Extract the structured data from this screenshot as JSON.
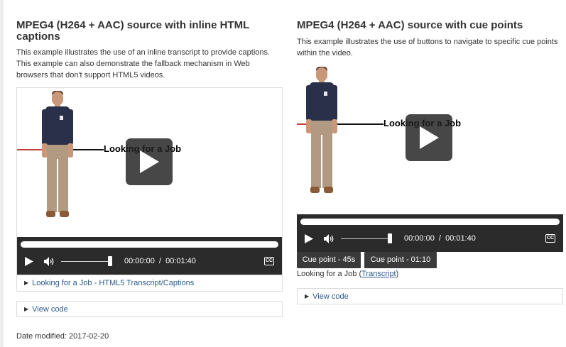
{
  "left": {
    "title": "MPEG4 (H264 + AAC) source with inline HTML captions",
    "description": "This example illustrates the use of an inline transcript to provide captions. This example can also demonstrate the fallback mechanism in Web browsers that don't support HTML5 videos.",
    "video_text": "Looking for a Job",
    "time": "00:00:00  /  00:01:40",
    "cc": "CC",
    "transcript_details": "Looking for a Job - HTML5 Transcript/Captions",
    "view_code": "View code"
  },
  "right": {
    "title": "MPEG4 (H264 + AAC) source with cue points",
    "description": "This example illustrates the use of buttons to navigate to specific cue points within the video.",
    "video_text": "Looking for a Job",
    "time": "00:00:00  /  00:01:40",
    "cc": "CC",
    "cue_buttons": [
      "Cue point - 45s",
      "Cue point - 01:10"
    ],
    "caption_prefix": "Looking for a Job (",
    "caption_link": "Transcript",
    "caption_suffix": ")",
    "view_code": "View code"
  },
  "footer": {
    "date_modified": "Date modified: 2017-02-20"
  },
  "icons": {
    "play": "play-icon",
    "volume": "volume-icon",
    "cc": "closed-captions-icon",
    "expand": "disclosure-triangle-icon"
  },
  "colors": {
    "control_bar": "#2b2b2b",
    "link": "#2b5a8c",
    "red_line": "#c24040"
  }
}
